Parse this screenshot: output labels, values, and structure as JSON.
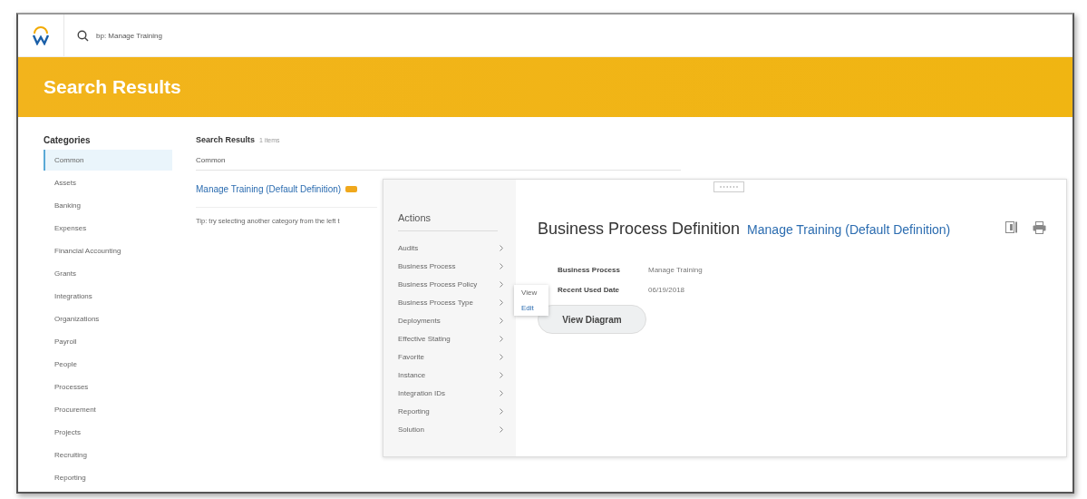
{
  "header": {
    "search_query": "bp: Manage Training"
  },
  "banner": {
    "title": "Search Results"
  },
  "categories": {
    "title": "Categories",
    "items": [
      {
        "label": "Common",
        "selected": true
      },
      {
        "label": "Assets",
        "selected": false
      },
      {
        "label": "Banking",
        "selected": false
      },
      {
        "label": "Expenses",
        "selected": false
      },
      {
        "label": "Financial Accounting",
        "selected": false
      },
      {
        "label": "Grants",
        "selected": false
      },
      {
        "label": "Integrations",
        "selected": false
      },
      {
        "label": "Organizations",
        "selected": false
      },
      {
        "label": "Payroll",
        "selected": false
      },
      {
        "label": "People",
        "selected": false
      },
      {
        "label": "Processes",
        "selected": false
      },
      {
        "label": "Procurement",
        "selected": false
      },
      {
        "label": "Projects",
        "selected": false
      },
      {
        "label": "Recruiting",
        "selected": false
      },
      {
        "label": "Reporting",
        "selected": false
      }
    ]
  },
  "results": {
    "title": "Search Results",
    "count": "1 items",
    "section": "Common",
    "link": "Manage Training (Default Definition)",
    "tip": "Tip: try selecting another category from the left t"
  },
  "actions": {
    "title": "Actions",
    "items": [
      {
        "label": "Audits"
      },
      {
        "label": "Business Process"
      },
      {
        "label": "Business Process Policy"
      },
      {
        "label": "Business Process Type"
      },
      {
        "label": "Deployments"
      },
      {
        "label": "Effective Stating"
      },
      {
        "label": "Favorite"
      },
      {
        "label": "Instance"
      },
      {
        "label": "Integration IDs"
      },
      {
        "label": "Reporting"
      },
      {
        "label": "Solution"
      }
    ]
  },
  "submenu": {
    "items": [
      {
        "label": "View",
        "kind": "plain"
      },
      {
        "label": "Edit",
        "kind": "link"
      }
    ]
  },
  "detail": {
    "title": "Business Process Definition",
    "link": "Manage Training (Default Definition)",
    "fields": [
      {
        "label": "Business Process",
        "value": "Manage Training"
      },
      {
        "label": "Recent Used Date",
        "value": "06/19/2018"
      }
    ],
    "button": "View Diagram"
  }
}
